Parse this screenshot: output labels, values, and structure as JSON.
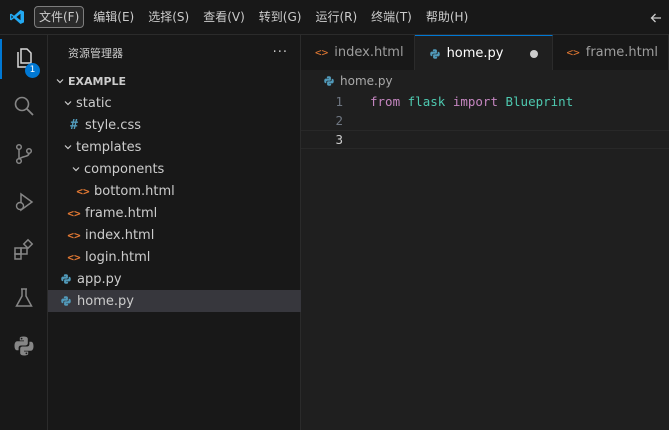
{
  "menu": {
    "items": [
      "文件(F)",
      "编辑(E)",
      "选择(S)",
      "查看(V)",
      "转到(G)",
      "运行(R)",
      "终端(T)",
      "帮助(H)"
    ]
  },
  "activity": {
    "explorer_badge": "1"
  },
  "explorer": {
    "title": "资源管理器",
    "more": "···",
    "root": "EXAMPLE",
    "tree": [
      {
        "label": "static",
        "kind": "folder-open"
      },
      {
        "label": "style.css",
        "kind": "css-file"
      },
      {
        "label": "templates",
        "kind": "folder-open"
      },
      {
        "label": "components",
        "kind": "folder-open"
      },
      {
        "label": "bottom.html",
        "kind": "html-file"
      },
      {
        "label": "frame.html",
        "kind": "html-file"
      },
      {
        "label": "index.html",
        "kind": "html-file"
      },
      {
        "label": "login.html",
        "kind": "html-file"
      },
      {
        "label": "app.py",
        "kind": "python-file"
      },
      {
        "label": "home.py",
        "kind": "python-file",
        "selected": true
      }
    ]
  },
  "tabs": [
    {
      "label": "index.html",
      "icon": "html-icon"
    },
    {
      "label": "home.py",
      "icon": "python-icon",
      "active": true,
      "dirty": true
    },
    {
      "label": "frame.html",
      "icon": "html-icon"
    }
  ],
  "editor": {
    "breadcrumb": "home.py",
    "lines": [
      {
        "number": "1",
        "tokens": {
          "from": "from",
          "module": "flask",
          "import": "import",
          "name": "Blueprint"
        }
      },
      {
        "number": "2"
      },
      {
        "number": "3",
        "current": true
      }
    ]
  },
  "colors": {
    "accent": "#0078d4",
    "keyword": "#c586c0",
    "module": "#4ec9b0",
    "html_icon": "#e37933",
    "css_icon": "#519aba",
    "python_icon": "#519aba"
  }
}
